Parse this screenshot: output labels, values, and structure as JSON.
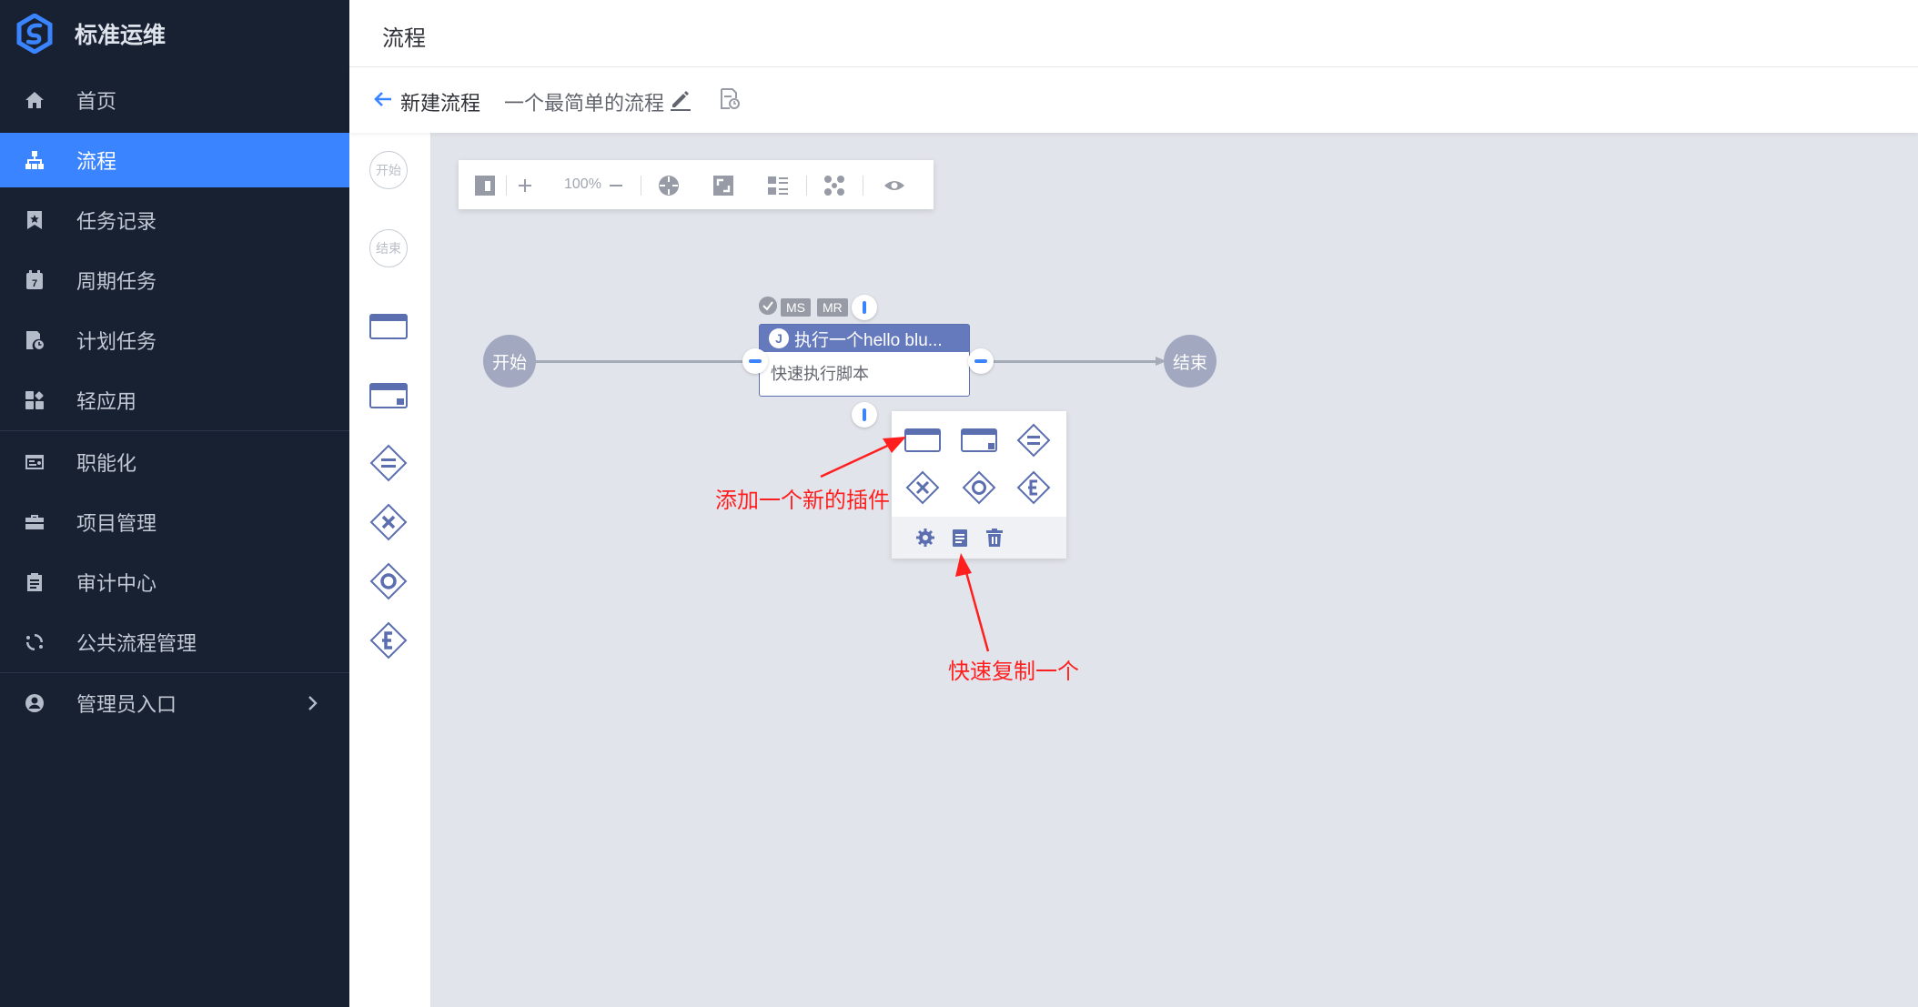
{
  "brand": {
    "name": "标准运维",
    "logo": "bk-sops-logo-icon"
  },
  "sidebar": {
    "items": [
      {
        "label": "首页",
        "icon": "home-icon"
      },
      {
        "label": "流程",
        "icon": "sitemap-icon",
        "active": true
      },
      {
        "label": "任务记录",
        "icon": "bookmark-icon"
      },
      {
        "label": "周期任务",
        "icon": "calendar-icon"
      },
      {
        "label": "计划任务",
        "icon": "schedule-doc-icon"
      },
      {
        "label": "轻应用",
        "icon": "apps-icon"
      },
      {
        "label": "职能化",
        "icon": "id-card-icon"
      },
      {
        "label": "项目管理",
        "icon": "briefcase-icon"
      },
      {
        "label": "审计中心",
        "icon": "clipboard-icon"
      },
      {
        "label": "公共流程管理",
        "icon": "cycle-icon"
      },
      {
        "label": "管理员入口",
        "icon": "user-circle-icon"
      }
    ]
  },
  "header": {
    "title": "流程"
  },
  "subbar": {
    "new_label": "新建流程",
    "flow_name": "一个最简单的流程"
  },
  "palette": {
    "start": "开始",
    "end": "结束"
  },
  "toolbar": {
    "zoom": "100%"
  },
  "canvas": {
    "start_label": "开始",
    "end_label": "结束",
    "task": {
      "badge": "J",
      "title": "执行一个hello blu...",
      "subtitle": "快速执行脚本"
    },
    "badges": [
      "MS",
      "MR"
    ]
  },
  "annotations": {
    "add_plugin": "添加一个新的插件",
    "quick_copy": "快速复制一个"
  },
  "colors": {
    "accent": "#3a84ff",
    "sidebar": "#182132",
    "node": "#6579bd",
    "annotation": "#ff1f1f"
  }
}
